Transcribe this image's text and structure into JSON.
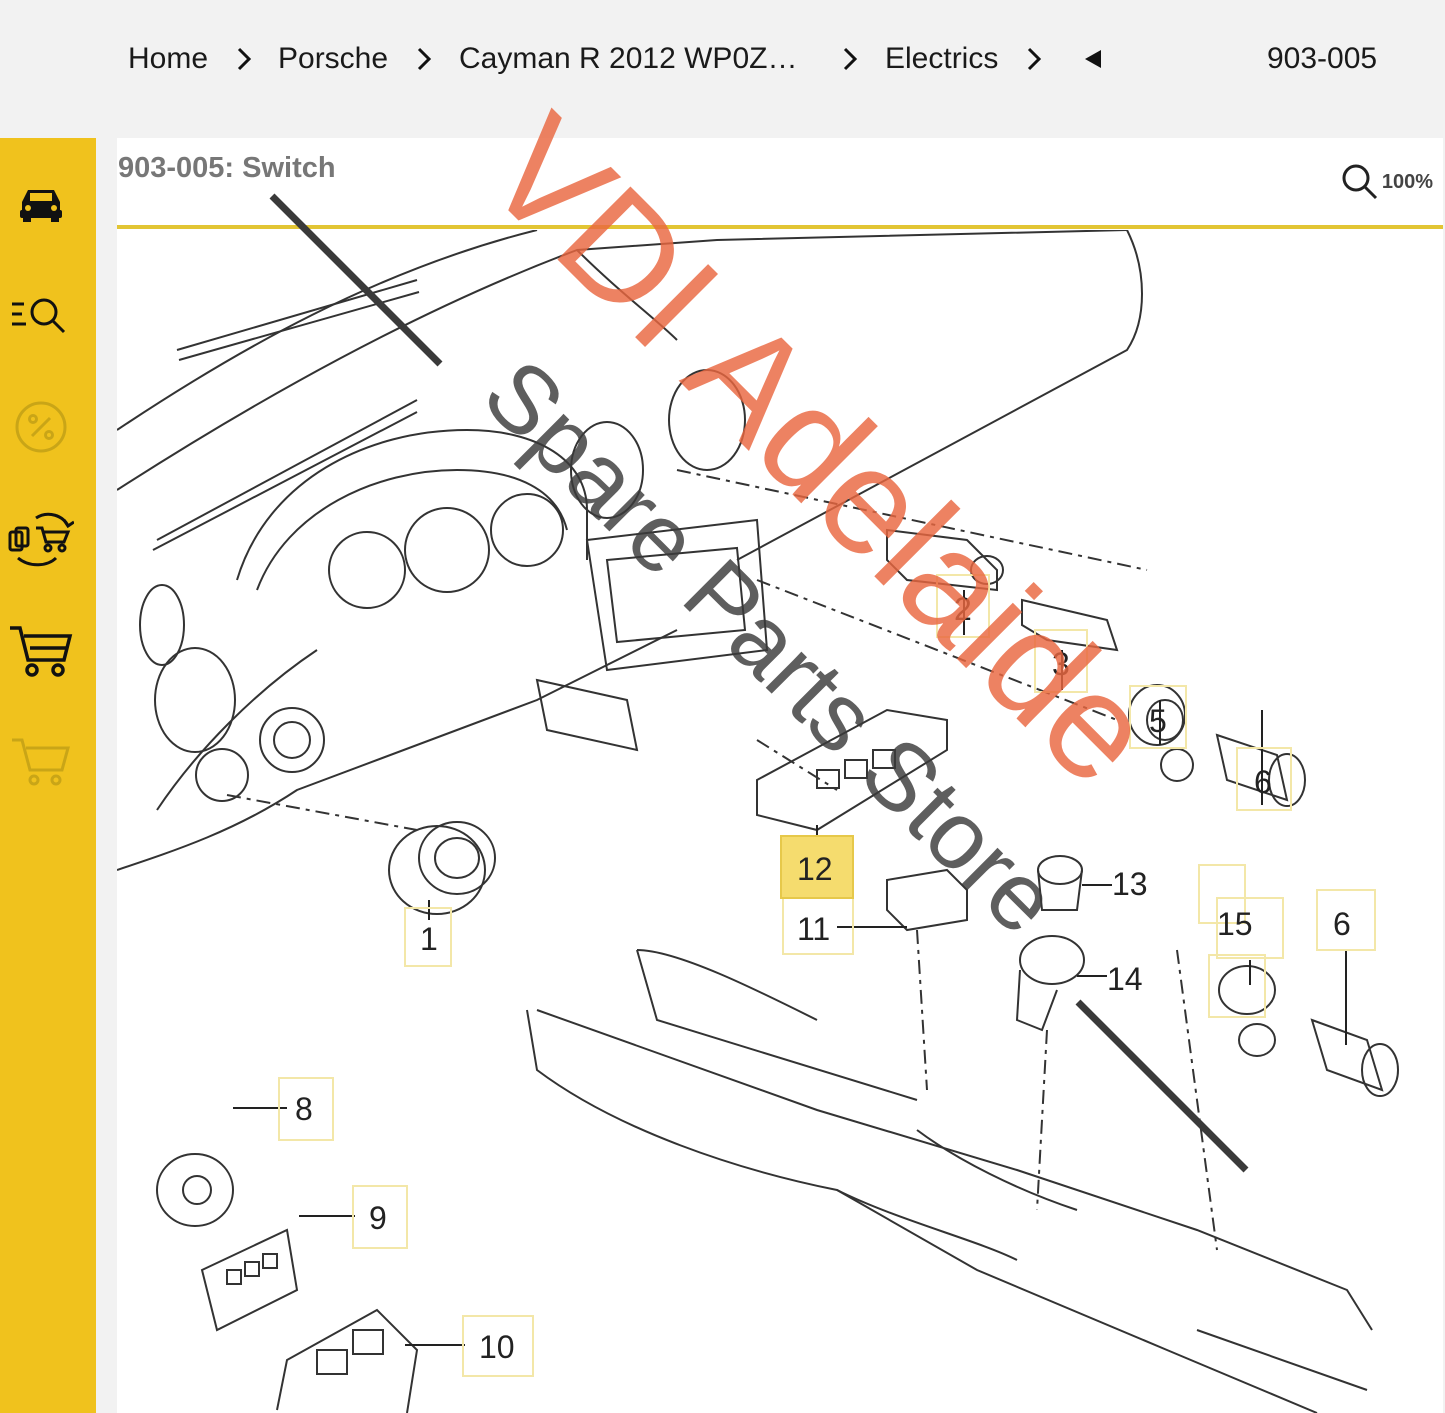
{
  "breadcrumb": {
    "items": [
      "Home",
      "Porsche",
      "Cayman R 2012 WP0Z…",
      "Electrics"
    ],
    "back_icon": "triangle-left-icon",
    "part_code": "903-005"
  },
  "sidebar": {
    "icons": [
      "car-icon",
      "search-list-icon",
      "percent-badge-icon",
      "exchange-cart-icon",
      "cart-icon",
      "cart-outline-icon"
    ]
  },
  "panel": {
    "title": "903-005: Switch",
    "zoom_label": "100%"
  },
  "watermark": {
    "line1": "VDI Adelaide",
    "line2": "Spare Parts Store"
  },
  "callouts": [
    "1",
    "2",
    "3",
    "5",
    "6",
    "12",
    "11",
    "13",
    "15",
    "6",
    "14",
    "8",
    "9",
    "10"
  ],
  "highlighted_callout": "12",
  "colors": {
    "accent": "#f0c21d",
    "watermark": "#e9673f",
    "highlight": "#f5dc6e"
  }
}
